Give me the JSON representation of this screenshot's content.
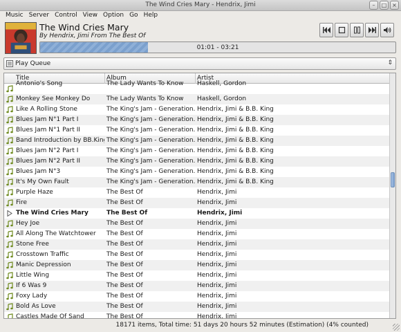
{
  "window": {
    "title": "The Wind Cries Mary - Hendrix, Jimi"
  },
  "menu": [
    "Music",
    "Server",
    "Control",
    "View",
    "Option",
    "Go",
    "Help"
  ],
  "now_playing": {
    "title": "The Wind Cries Mary",
    "by_label": "By",
    "artist": "Hendrix, Jimi",
    "from_label": "From",
    "album": "The Best Of",
    "time_text": "01:01 - 03:21",
    "progress_fraction": 0.303
  },
  "controls": [
    "previous-icon",
    "stop-icon",
    "pause-icon",
    "next-icon",
    "volume-icon"
  ],
  "playlist_selector": {
    "label": "Play Queue"
  },
  "table": {
    "columns": [
      "Title",
      "Album",
      "Artist"
    ],
    "rows": [
      {
        "title": "Antonio's Song",
        "album": "The Lady Wants To Know",
        "artist": "Haskell, Gordon"
      },
      {
        "title": "Monkey See Monkey Do",
        "album": "The Lady Wants To Know",
        "artist": "Haskell, Gordon"
      },
      {
        "title": "Like A Rolling Stone",
        "album": "The King's Jam - Generation...",
        "artist": "Hendrix, Jimi & B.B. King"
      },
      {
        "title": "Blues Jam N°1 Part I",
        "album": "The King's Jam - Generation...",
        "artist": "Hendrix, Jimi & B.B. King"
      },
      {
        "title": "Blues Jam N°1 Part II",
        "album": "The King's Jam - Generation...",
        "artist": "Hendrix, Jimi & B.B. King"
      },
      {
        "title": "Band Introduction by BB.King",
        "album": "The King's Jam - Generation...",
        "artist": "Hendrix, Jimi & B.B. King"
      },
      {
        "title": "Blues Jam N°2 Part I",
        "album": "The King's Jam - Generation...",
        "artist": "Hendrix, Jimi & B.B. King"
      },
      {
        "title": "Blues Jam N°2 Part II",
        "album": "The King's Jam - Generation...",
        "artist": "Hendrix, Jimi & B.B. King"
      },
      {
        "title": "Blues Jam N°3",
        "album": "The King's Jam - Generation...",
        "artist": "Hendrix, Jimi & B.B. King"
      },
      {
        "title": "It's My Own Fault",
        "album": "The King's Jam - Generation...",
        "artist": "Hendrix, Jimi & B.B. King"
      },
      {
        "title": "Purple Haze",
        "album": "The Best Of",
        "artist": "Hendrix, Jimi"
      },
      {
        "title": "Fire",
        "album": "The Best Of",
        "artist": "Hendrix, Jimi"
      },
      {
        "title": "The Wind Cries Mary",
        "album": "The Best Of",
        "artist": "Hendrix, Jimi",
        "current": true
      },
      {
        "title": "Hey Joe",
        "album": "The Best Of",
        "artist": "Hendrix, Jimi"
      },
      {
        "title": "All Along The Watchtower",
        "album": "The Best Of",
        "artist": "Hendrix, Jimi"
      },
      {
        "title": "Stone Free",
        "album": "The Best Of",
        "artist": "Hendrix, Jimi"
      },
      {
        "title": "Crosstown Traffic",
        "album": "The Best Of",
        "artist": "Hendrix, Jimi"
      },
      {
        "title": "Manic Depression",
        "album": "The Best Of",
        "artist": "Hendrix, Jimi"
      },
      {
        "title": "Little Wing",
        "album": "The Best Of",
        "artist": "Hendrix, Jimi"
      },
      {
        "title": "If 6 Was 9",
        "album": "The Best Of",
        "artist": "Hendrix, Jimi"
      },
      {
        "title": "Foxy Lady",
        "album": "The Best Of",
        "artist": "Hendrix, Jimi"
      },
      {
        "title": "Bold As Love",
        "album": "The Best Of",
        "artist": "Hendrix, Jimi"
      },
      {
        "title": "Castles Made Of Sand",
        "album": "The Best Of",
        "artist": "Hendrix, Jimi"
      }
    ]
  },
  "status": {
    "text": "18171 items,  Total time: 51 days 20 hours 52 minutes (Estimation) (4% counted)"
  },
  "colors": {
    "progress_fill": "#8fb0d8",
    "note_icon": "#6f8a1f",
    "row_alt": "#f0f0f0"
  }
}
